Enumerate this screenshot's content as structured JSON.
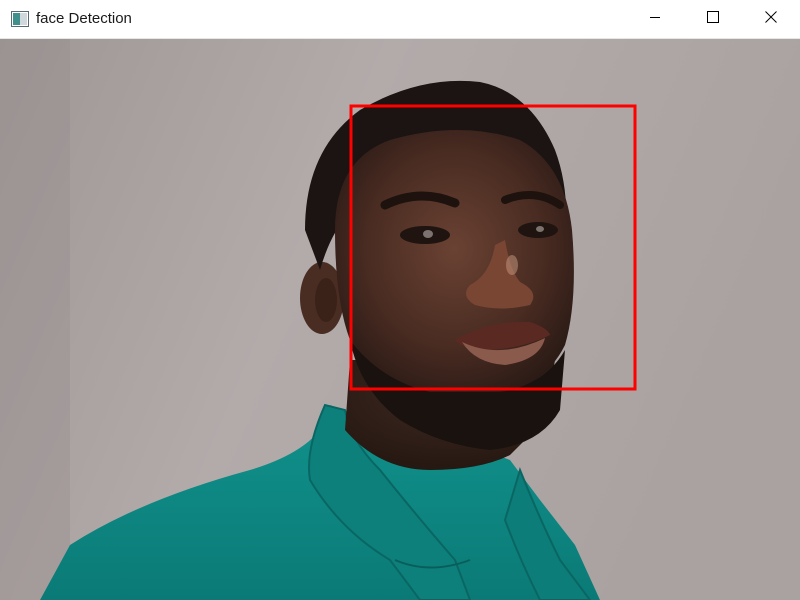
{
  "window": {
    "title": "face Detection",
    "app_icon": "window-app-icon",
    "controls": {
      "minimize_icon": "minimize-icon",
      "maximize_icon": "maximize-icon",
      "close_icon": "close-icon"
    }
  },
  "camera_frame": {
    "detections": [
      {
        "label": "face",
        "box_color": "#ff0000"
      }
    ],
    "shirt_color": "#0f8a86",
    "wall_color": "#a9a19f"
  }
}
